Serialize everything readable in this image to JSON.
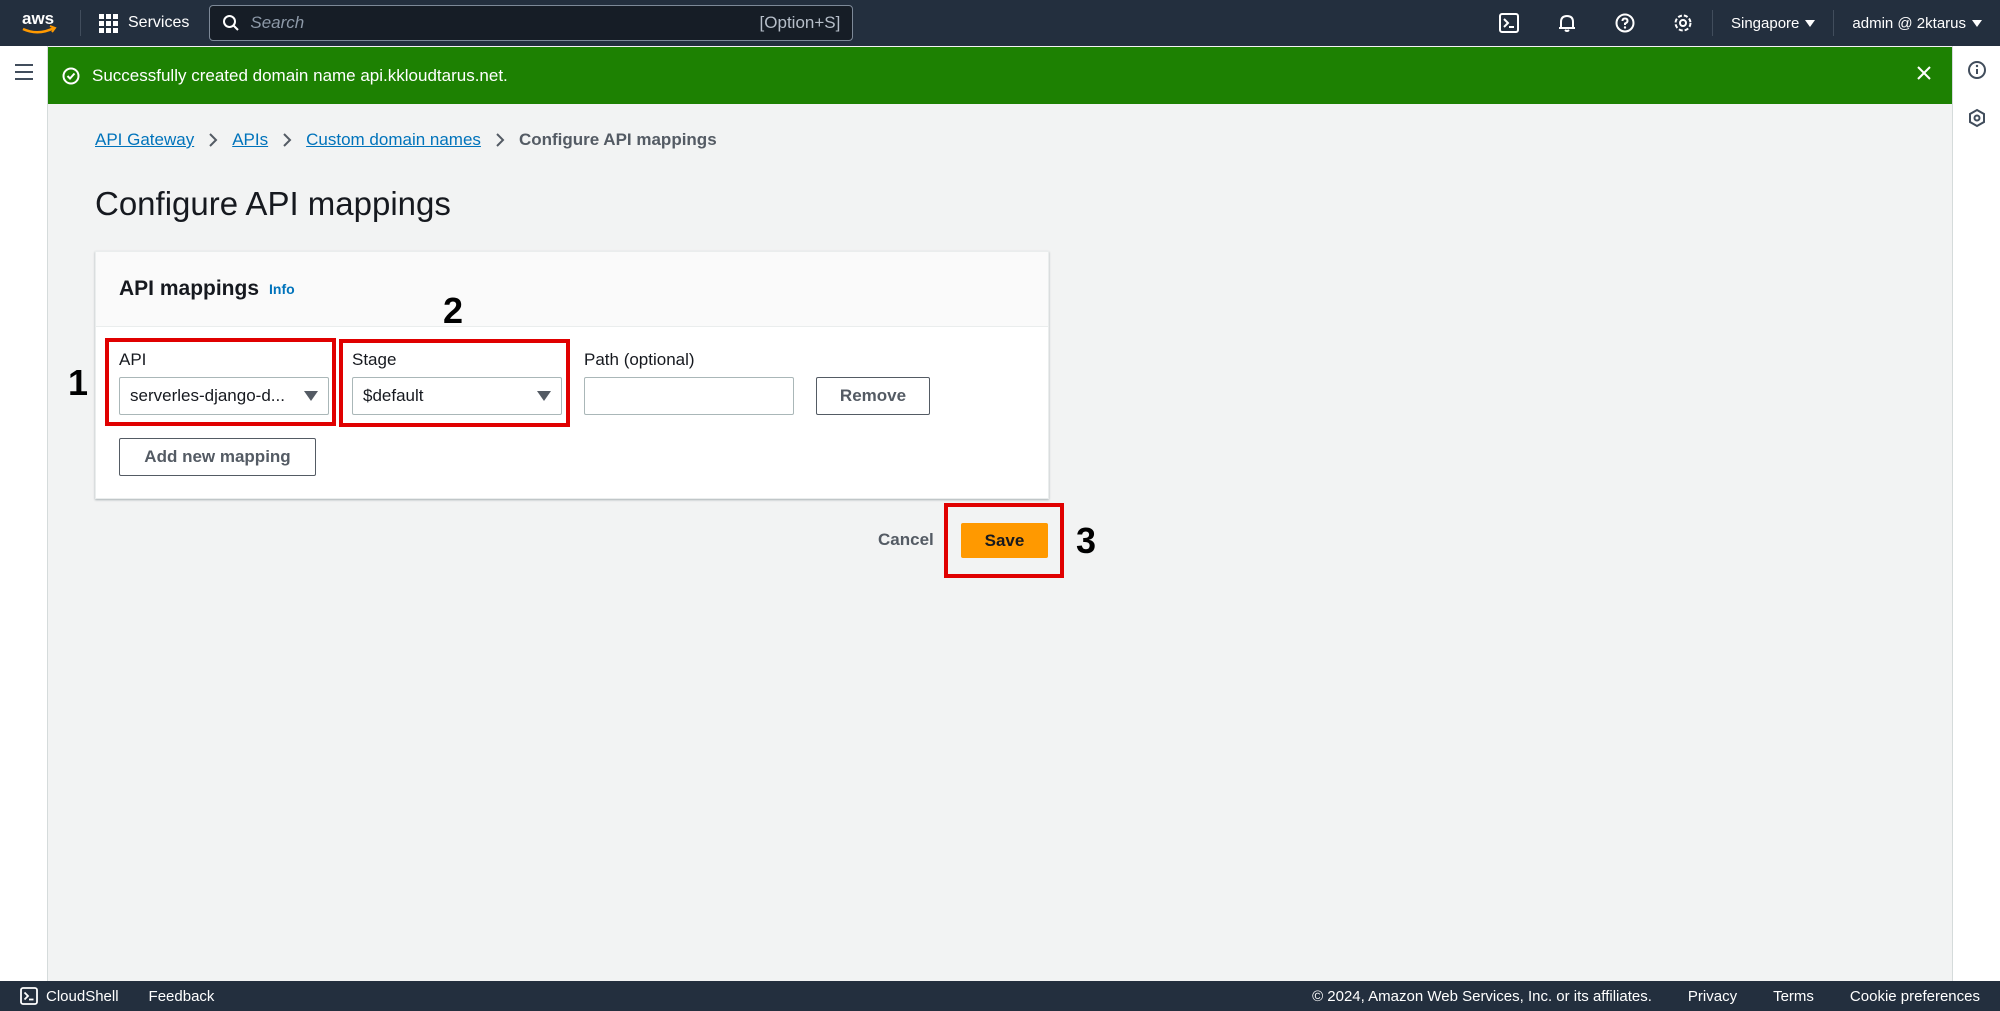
{
  "topnav": {
    "logo": "aws",
    "services_label": "Services",
    "search_placeholder": "Search",
    "search_shortcut": "[Option+S]",
    "region": "Singapore",
    "account": "admin @ 2ktarus",
    "icons": [
      "cloudshell-icon",
      "bell-icon",
      "help-icon",
      "gear-icon"
    ]
  },
  "flash": {
    "message": "Successfully created domain name api.kkloudtarus.net.",
    "color": "#1d8102"
  },
  "breadcrumb": {
    "items": [
      "API Gateway",
      "APIs",
      "Custom domain names"
    ],
    "current": "Configure API mappings"
  },
  "page": {
    "title": "Configure API mappings"
  },
  "panel": {
    "title": "API mappings",
    "info": "Info",
    "api_label": "API",
    "api_value": "serverles-django-d...",
    "stage_label": "Stage",
    "stage_value": "$default",
    "path_label": "Path (optional)",
    "path_value": "",
    "remove_label": "Remove",
    "add_label": "Add new mapping"
  },
  "actions": {
    "cancel": "Cancel",
    "save": "Save",
    "save_color": "#ff9900"
  },
  "annotations": {
    "one": "1",
    "two": "2",
    "three": "3",
    "box_color": "#e00000"
  },
  "footer": {
    "cloudshell": "CloudShell",
    "feedback": "Feedback",
    "copyright": "© 2024, Amazon Web Services, Inc. or its affiliates.",
    "privacy": "Privacy",
    "terms": "Terms",
    "cookies": "Cookie preferences"
  }
}
